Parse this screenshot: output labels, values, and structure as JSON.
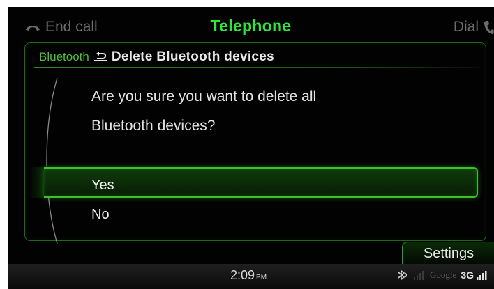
{
  "topbar": {
    "left_label": "End call",
    "title": "Telephone",
    "right_label": "Dial",
    "accent": "#2ee53c"
  },
  "breadcrumb": {
    "parent": "Bluetooth",
    "current": "Delete Bluetooth devices"
  },
  "dialog": {
    "question_line1": "Are you sure you want to delete all",
    "question_line2": "Bluetooth devices?",
    "options": [
      {
        "label": "Yes",
        "selected": true
      },
      {
        "label": "No",
        "selected": false
      }
    ]
  },
  "settings_tab": {
    "label": "Settings"
  },
  "statusbar": {
    "time": "2:09",
    "ampm": "PM",
    "carrier": "Google",
    "network": "3G",
    "icons": [
      "bluetooth-icon",
      "signal-weak-icon",
      "signal-icon"
    ]
  }
}
